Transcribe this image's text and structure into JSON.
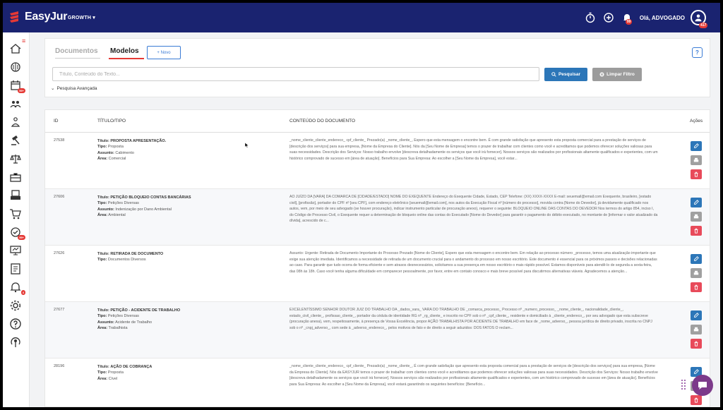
{
  "app": {
    "brand_prefix": "Easy",
    "brand_suffix": "Jur",
    "plan": "GROWTH",
    "greeting": "Olá, ADVOGADO",
    "notif_count": "99",
    "avatar_badge": "417"
  },
  "sidebar": {
    "items": [
      {
        "icon": "home-icon"
      },
      {
        "icon": "brain-icon"
      },
      {
        "icon": "calendar-icon",
        "badge": "99+"
      },
      {
        "icon": "people-icon"
      },
      {
        "icon": "scales-person-icon"
      },
      {
        "icon": "gavel-icon"
      },
      {
        "icon": "justice-icon"
      },
      {
        "icon": "briefcase-icon"
      },
      {
        "icon": "printer-doc-icon"
      },
      {
        "icon": "cart-icon"
      },
      {
        "icon": "tasks-icon",
        "badge": "99+"
      },
      {
        "icon": "presentation-icon"
      },
      {
        "icon": "report-icon"
      },
      {
        "icon": "alarm-icon",
        "badge": "4"
      },
      {
        "icon": "gear-icon"
      },
      {
        "icon": "question-icon"
      },
      {
        "icon": "broadcast-icon"
      }
    ]
  },
  "tabs": {
    "documentos": "Documentos",
    "modelos": "Modelos",
    "novo": "+ Novo",
    "help": "?"
  },
  "search": {
    "placeholder": "Título, Conteúdo do Texto...",
    "value": "",
    "search_label": "Pesquisar",
    "clear_label": "Limpar Filtro",
    "advanced_label": "Pesquisa Avançada"
  },
  "table": {
    "headers": {
      "id": "ID",
      "title": "TÍTULO/TIPO",
      "content": "CONTEÚDO DO DOCUMENTO",
      "actions": "Ações"
    },
    "labels": {
      "titulo": "Título:",
      "tipo": "Tipo:",
      "assunto": "Assunto:",
      "area": "Área:"
    },
    "rows": [
      {
        "id": "27538",
        "titulo": "PROPOSTA APRESENTAÇÃO.",
        "tipo": "Proposta",
        "assunto": "Cabimento",
        "area": "Comercial",
        "content": "_nome_cliente_cliente_endereco_ cpf_cliente_ Prezado(a) _nome_cliente_, Espero que esta mensagem o encontre bem. É com grande satisfação que apresento esta proposta comercial para a prestação de serviços de [descrição dos serviços] para sua empresa, [Nome da Empresa do Cliente]. Nós da [Seu Nome de Empresa] temos o prazer de trabalhar com clientes como você e acreditamos que podemos oferecer soluções valiosas para suas necessidades. Descrição dos Serviços: Nosso trabalho envolve [descreva detalhadamente os serviços que você irá fornecer]. Nossos serviços são realizados por profissionais altamente qualificados e experientes, com um histórico comprovado de sucesso em [área de atuação]. Benefícios para Sua Empresa: Ao escolher a [Seu Nome da Empresa], você estar..."
      },
      {
        "id": "27606",
        "titulo": "PETIÇÃO BLOQUEIO CONTAS BANCÁRIAS",
        "tipo": "Petições Diversas",
        "assunto": "Indenização por Dano Ambiental",
        "area": "Ambiental",
        "content": "AO JUÍZO DA [VARA] DA COMARCA DE [CIDADE/ESTADO] NOME DO EXEQUENTE Endereço do Exequente Cidade, Estado, CEP Telefone: (XX) XXXX-XXXX E-mail: seuemail@email.com Exequente, brasileiro, [estado civil], [profissão], portador do CPF nº [seu CPF], com endereço eletrônico [seuemail@email.com], nos autos da Execução Fiscal nº [número do processo], movida contra [Nome do Devedor], já devidamente qualificado nos autos, vem, por meio de seu advogado (se houver procuração), indicar instrumento particular de procuração anexo), requerer o seguinte: BLOQUEIO ONLINE DAS CONTAS DO DEVEDOR Nos termos do artigo 854, inciso I, do Código de Processo Civil, o Exequente requer a determinação de bloqueio online das contas do Executado [Nome do Devedor] para garantir o pagamento do débito executado, no montante de [informar o valor atualizado da dívida], acrescido de c..."
      },
      {
        "id": "27626",
        "titulo": "RETIRADA DE DOCUMENTO",
        "tipo": "Documentos Diversos",
        "assunto": "",
        "area": "",
        "content": "Assunto: Urgente: Retirada de Documento Importante do Processo Prezado [Nome do Cliente], Espero que esta mensagem o encontre bem. Em relação ao processo número _processo, temos uma atualização importante que exige sua atenção imediata. Identificamos a necessidade de retirada de um documento crucial para o andamento do processo em nosso escritório. Este documento é essencial para os próximos passos e decisões relacionadas ao caso. Para garantir que tudo ocorra de forma eficiente e sem atrasos desnecessários, solicitamos a sua presença em nosso escritório o mais rápido possível. Estamos disponíveis para atendê-lo de segunda a sexta-feira, das 08h às 18h. Caso você tenha alguma dificuldade em comparecer pessoalmente, por favor, entre em contato conosco e mais breve possível para discutirmos alternativas viáveis. Agradecemos a atenção..."
      },
      {
        "id": "27677",
        "titulo": "PETIÇÃO - ACIDENTE DE TRABALHO",
        "tipo": "Petições Diversas",
        "assunto": "Acidente de Trabalho",
        "area": "Trabalhista",
        "content": "EXCELENTÍSSIMO SENHOR DOUTOR JUIZ DO TRABALHO DA _dados_vara_ VARA DO TRABALHO DE _comarca_processo_ Processo nº _numero_processo_ _nome_cliente_, nacionalidade_cliente_, estado_civil_cliente_, profissao_cliente_, portador da cédula de identidade RG nº _rg_cliente_ e inscrito no CPF sob o nº _cpf_cliente_, residente e domiciliado à _cliente_endereco_, por seu advogado que esta subscreve (procuração anexa), vem, respeitosamente, à presença de Vossa Excelência, propor AÇÃO TRABALHISTA POR ACIDENTE DE TRABALHO em face de _nome_adverso_, pessoa jurídica de direito privado, inscrita no CNPJ sob o nº _cnpj_adverso_, com sede à _adverso_endereco_, pelos motivos de fato e de direito a seguir aduzidos: DOS FATOS O reclam..."
      },
      {
        "id": "28196",
        "titulo": "AÇÃO DE COBRANÇA",
        "tipo": "Proposta",
        "assunto": "",
        "area": "Cível",
        "content": "_nome_cliente_cliente_endereco_ cpf_cliente_ Prezado(a) _nome_cliente_, É com grande satisfação que apresento esta proposta comercial para a prestação de serviços de [descrição dos serviços] para sua empresa, [Nome da Empresa do Cliente]. Nós da EASYJUR temos o prazer de trabalhar com clientes como você e acreditamos que podemos oferecer soluções valiosas para suas necessidades. Descrição dos Serviços: Nosso trabalho envolve [descreva detalhadamente os serviços que você irá fornecer]. Nossos serviços são realizados por profissionais altamente qualificados e experientes, com um histórico comprovado de sucesso em [área de atuação]. Benefícios para Sua Empresa: Ao escolher a [Seu Nome da Empresa], você estará garantindo os seguintes benefícios: [Benefício..."
      }
    ]
  },
  "colors": {
    "topbar": "#1a2370",
    "accent": "#e53935",
    "primary": "#2c76b8",
    "chat": "#7c3a8a"
  }
}
